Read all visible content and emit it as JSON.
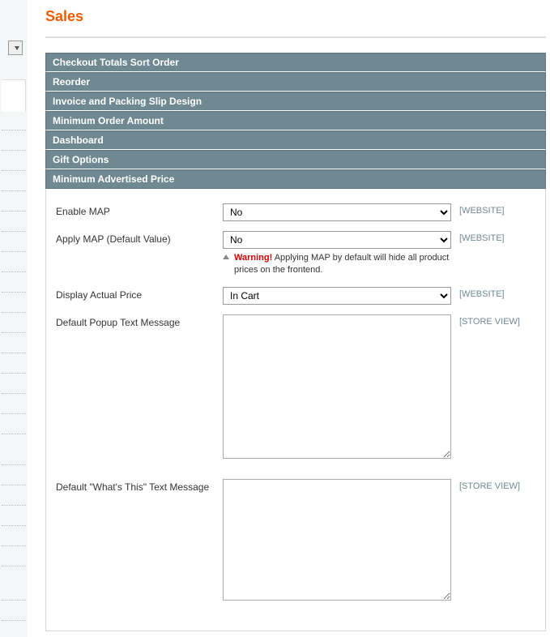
{
  "page": {
    "title": "Sales"
  },
  "sections": {
    "checkout_sort": "Checkout Totals Sort Order",
    "reorder": "Reorder",
    "invoice": "Invoice and Packing Slip Design",
    "min_order": "Minimum Order Amount",
    "dashboard": "Dashboard",
    "gift": "Gift Options",
    "map": "Minimum Advertised Price"
  },
  "fields": {
    "enable_map": {
      "label": "Enable MAP",
      "value": "No",
      "scope": "[WEBSITE]"
    },
    "apply_map": {
      "label": "Apply MAP (Default Value)",
      "value": "No",
      "scope": "[WEBSITE]",
      "warning_label": "Warning!",
      "warning_text": " Applying MAP by default will hide all product prices on the frontend."
    },
    "display_price": {
      "label": "Display Actual Price",
      "value": "In Cart",
      "scope": "[WEBSITE]"
    },
    "popup_text": {
      "label": "Default Popup Text Message",
      "value": "",
      "scope": "[STORE VIEW]"
    },
    "whats_this": {
      "label": "Default \"What's This\" Text Message",
      "value": "",
      "scope": "[STORE VIEW]"
    }
  }
}
